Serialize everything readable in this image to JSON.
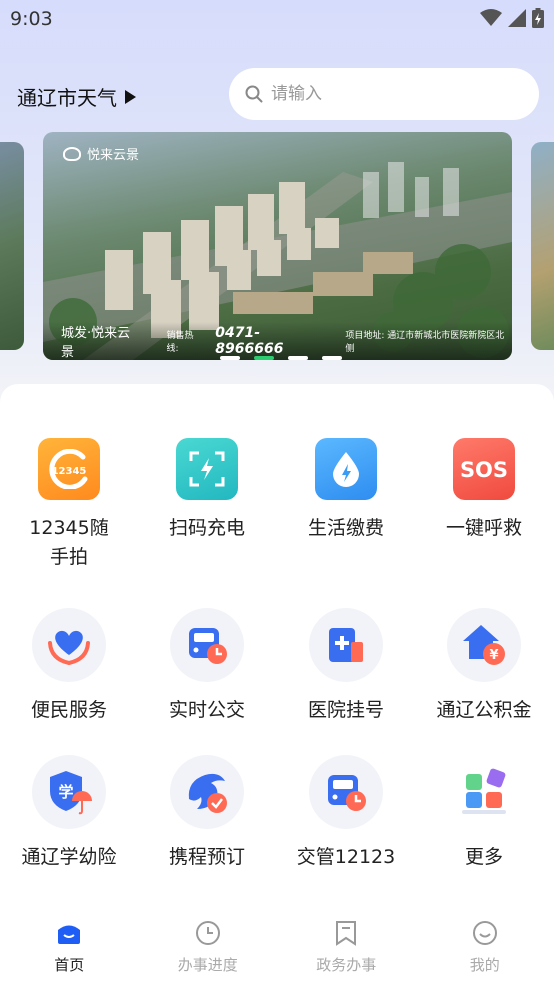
{
  "status_bar": {
    "time": "9:03"
  },
  "header": {
    "weather_label": "通辽市天气",
    "search_placeholder": "请输入"
  },
  "banner": {
    "logo_text": "悦来云景",
    "name": "城发·悦来云景",
    "hotline_label": "销售热线:",
    "hotline": "0471-8966666",
    "address": "项目地址: 通辽市新城北市医院新院区北侧",
    "slide_count": 4,
    "active_slide": 1
  },
  "services_row1": [
    {
      "label": "12345随手拍",
      "icon": "camera-12345-icon",
      "color": "#ff9a2e"
    },
    {
      "label": "扫码充电",
      "icon": "scan-charge-icon",
      "color": "#2ec6c6"
    },
    {
      "label": "生活缴费",
      "icon": "water-drop-icon",
      "color": "#3b9cf5"
    },
    {
      "label": "一键呼救",
      "icon": "sos-icon",
      "color": "#f25a4a"
    }
  ],
  "services_row2": [
    {
      "label": "便民服务",
      "icon": "heart-hands-icon"
    },
    {
      "label": "实时公交",
      "icon": "bus-clock-icon"
    },
    {
      "label": "医院挂号",
      "icon": "hospital-icon"
    },
    {
      "label": "通辽公积金",
      "icon": "house-yuan-icon"
    }
  ],
  "services_row3": [
    {
      "label": "通辽学幼险",
      "icon": "school-shield-icon"
    },
    {
      "label": "携程预订",
      "icon": "dolphin-icon"
    },
    {
      "label": "交管12123",
      "icon": "bus-clock-icon"
    },
    {
      "label": "更多",
      "icon": "more-blocks-icon"
    }
  ],
  "bottom_nav": [
    {
      "label": "首页",
      "icon": "home-icon",
      "active": true
    },
    {
      "label": "办事进度",
      "icon": "clock-icon",
      "active": false
    },
    {
      "label": "政务办事",
      "icon": "bookmark-icon",
      "active": false
    },
    {
      "label": "我的",
      "icon": "smile-icon",
      "active": false
    }
  ],
  "colors": {
    "accent": "#1e5ef5",
    "active_dot": "#2ecc71"
  }
}
